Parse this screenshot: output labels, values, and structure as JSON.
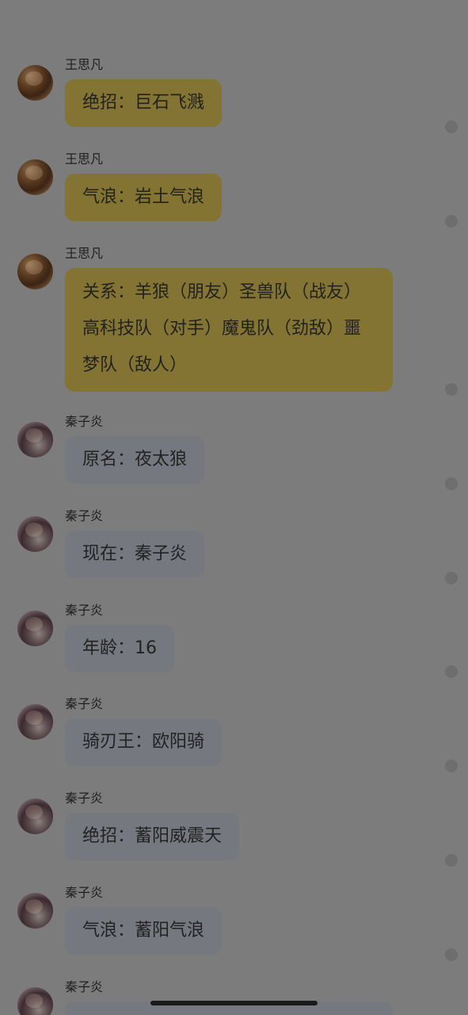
{
  "messages": [
    {
      "sender": "王思凡",
      "text": "绝招：巨石飞溅",
      "style": "yellow"
    },
    {
      "sender": "王思凡",
      "text": "气浪：岩土气浪",
      "style": "yellow"
    },
    {
      "sender": "王思凡",
      "text": "关系：羊狼（朋友）圣兽队（战友）高科技队（对手）魔鬼队（劲敌）噩梦队（敌人）",
      "style": "yellow"
    },
    {
      "sender": "秦子炎",
      "text": "原名：夜太狼",
      "style": "gray"
    },
    {
      "sender": "秦子炎",
      "text": "现在：秦子炎",
      "style": "gray"
    },
    {
      "sender": "秦子炎",
      "text": "年龄：16",
      "style": "gray"
    },
    {
      "sender": "秦子炎",
      "text": "骑刃王：欧阳骑",
      "style": "gray"
    },
    {
      "sender": "秦子炎",
      "text": "绝招：蓄阳威震天",
      "style": "gray"
    },
    {
      "sender": "秦子炎",
      "text": "气浪：蓄阳气浪",
      "style": "gray"
    },
    {
      "sender": "秦子炎",
      "text": "",
      "style": "gray"
    }
  ],
  "colors": {
    "background": "#7c7c7c",
    "bubble_yellow": "#837433",
    "bubble_gray": "#75787f"
  }
}
